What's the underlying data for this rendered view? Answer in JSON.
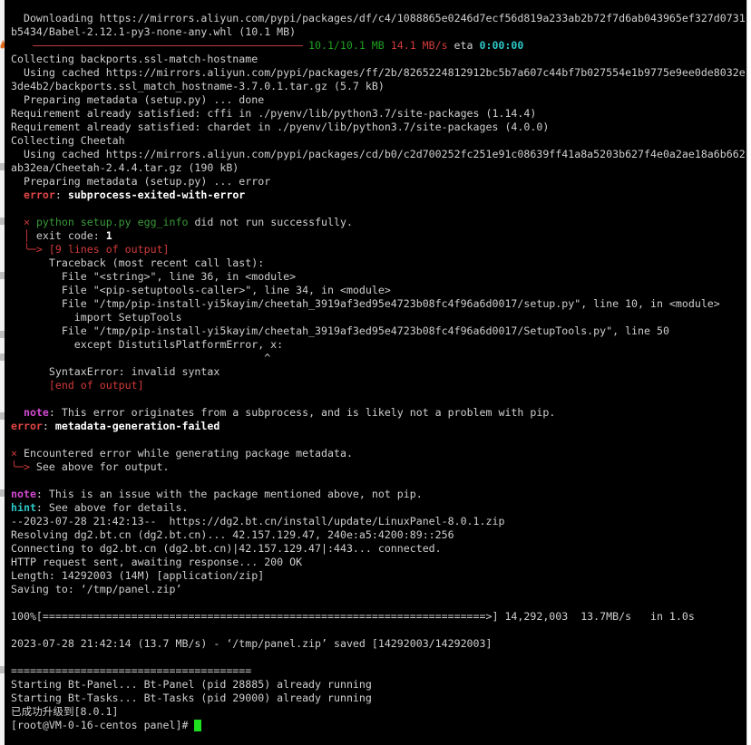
{
  "terminal": {
    "lines": [
      {
        "segments": [
          {
            "t": "  Downloading https://mirrors.aliyun.com/pypi/packages/df/c4/1088865e0246d7ecf56d819a233ab2b72f7d6ab043965ef327d0731"
          }
        ]
      },
      {
        "segments": [
          {
            "t": "b5434/Babel-2.12.1-py3-none-any.whl (10.1 MB)"
          }
        ]
      },
      {
        "progress": true,
        "segments": [
          {
            "t": "10.1/10.1 MB",
            "c": "c-green2"
          },
          {
            "t": " "
          },
          {
            "t": "14.1 MB/s",
            "c": "c-red"
          },
          {
            "t": " eta "
          },
          {
            "t": "0:00:00",
            "c": "c-cyan"
          }
        ]
      },
      {
        "segments": [
          {
            "t": "Collecting backports.ssl-match-hostname"
          }
        ]
      },
      {
        "segments": [
          {
            "t": "  Using cached https://mirrors.aliyun.com/pypi/packages/ff/2b/8265224812912bc5b7a607c44bf7b027554e1b9775e9ee0de8032e"
          }
        ]
      },
      {
        "segments": [
          {
            "t": "3de4b2/backports.ssl_match_hostname-3.7.0.1.tar.gz (5.7 kB)"
          }
        ]
      },
      {
        "segments": [
          {
            "t": "  Preparing metadata (setup.py) ... done"
          }
        ]
      },
      {
        "segments": [
          {
            "t": "Requirement already satisfied: cffi in ./pyenv/lib/python3.7/site-packages (1.14.4)"
          }
        ]
      },
      {
        "segments": [
          {
            "t": "Requirement already satisfied: chardet in ./pyenv/lib/python3.7/site-packages (4.0.0)"
          }
        ]
      },
      {
        "segments": [
          {
            "t": "Collecting Cheetah"
          }
        ]
      },
      {
        "segments": [
          {
            "t": "  Using cached https://mirrors.aliyun.com/pypi/packages/cd/b0/c2d700252fc251e91c08639ff41a8a5203b627f4e0a2ae18a6b662"
          }
        ]
      },
      {
        "segments": [
          {
            "t": "ab32ea/Cheetah-2.4.4.tar.gz (190 kB)"
          }
        ]
      },
      {
        "segments": [
          {
            "t": "  Preparing metadata (setup.py) ... error"
          }
        ]
      },
      {
        "segments": [
          {
            "t": "  "
          },
          {
            "t": "error",
            "c": "c-redb"
          },
          {
            "t": ": "
          },
          {
            "t": "subprocess-exited-with-error",
            "c": "c-whiteb"
          }
        ]
      },
      {
        "segments": [
          {
            "t": ""
          }
        ]
      },
      {
        "segments": [
          {
            "t": "  "
          },
          {
            "t": "×",
            "c": "c-red"
          },
          {
            "t": " "
          },
          {
            "t": "python setup.py egg_info",
            "c": "c-green"
          },
          {
            "t": " did not run successfully."
          }
        ]
      },
      {
        "segments": [
          {
            "t": "  "
          },
          {
            "t": "│",
            "c": "c-red"
          },
          {
            "t": " exit code: "
          },
          {
            "t": "1",
            "c": "c-whiteb"
          }
        ]
      },
      {
        "segments": [
          {
            "t": "  "
          },
          {
            "t": "╰─>",
            "c": "c-red"
          },
          {
            "t": " "
          },
          {
            "t": "[9 lines of output]",
            "c": "c-red"
          }
        ]
      },
      {
        "segments": [
          {
            "t": "      Traceback (most recent call last):"
          }
        ]
      },
      {
        "segments": [
          {
            "t": "        File \"<string>\", line 36, in <module>"
          }
        ]
      },
      {
        "segments": [
          {
            "t": "        File \"<pip-setuptools-caller>\", line 34, in <module>"
          }
        ]
      },
      {
        "segments": [
          {
            "t": "        File \"/tmp/pip-install-yi5kayim/cheetah_3919af3ed95e4723b08fc4f96a6d0017/setup.py\", line 10, in <module>"
          }
        ]
      },
      {
        "segments": [
          {
            "t": "          import SetupTools"
          }
        ]
      },
      {
        "segments": [
          {
            "t": "        File \"/tmp/pip-install-yi5kayim/cheetah_3919af3ed95e4723b08fc4f96a6d0017/SetupTools.py\", line 50"
          }
        ]
      },
      {
        "segments": [
          {
            "t": "          except DistutilsPlatformError, x:"
          }
        ]
      },
      {
        "segments": [
          {
            "t": "                                        ^"
          }
        ]
      },
      {
        "segments": [
          {
            "t": "      SyntaxError: invalid syntax"
          }
        ]
      },
      {
        "segments": [
          {
            "t": "      "
          },
          {
            "t": "[end of output]",
            "c": "c-red"
          }
        ]
      },
      {
        "segments": [
          {
            "t": ""
          }
        ]
      },
      {
        "segments": [
          {
            "t": "  "
          },
          {
            "t": "note",
            "c": "c-magenta"
          },
          {
            "t": ": This error originates from a subprocess, and is likely not a problem with pip."
          }
        ]
      },
      {
        "segments": [
          {
            "t": "error",
            "c": "c-redb"
          },
          {
            "t": ": "
          },
          {
            "t": "metadata-generation-failed",
            "c": "c-whiteb"
          }
        ]
      },
      {
        "segments": [
          {
            "t": ""
          }
        ]
      },
      {
        "segments": [
          {
            "t": "×",
            "c": "c-red"
          },
          {
            "t": " Encountered error while generating package metadata."
          }
        ]
      },
      {
        "segments": [
          {
            "t": "╰─>",
            "c": "c-red"
          },
          {
            "t": " See above for output."
          }
        ]
      },
      {
        "segments": [
          {
            "t": ""
          }
        ]
      },
      {
        "segments": [
          {
            "t": "note",
            "c": "c-magenta"
          },
          {
            "t": ": This is an issue with the package mentioned above, not pip."
          }
        ]
      },
      {
        "segments": [
          {
            "t": "hint",
            "c": "c-cyan"
          },
          {
            "t": ": See above for details."
          }
        ]
      },
      {
        "segments": [
          {
            "t": "--2023-07-28 21:42:13--  https://dg2.bt.cn/install/update/LinuxPanel-8.0.1.zip"
          }
        ]
      },
      {
        "segments": [
          {
            "t": "Resolving dg2.bt.cn (dg2.bt.cn)... 42.157.129.47, 240e:a5:4200:89::256"
          }
        ]
      },
      {
        "segments": [
          {
            "t": "Connecting to dg2.bt.cn (dg2.bt.cn)|42.157.129.47|:443... connected."
          }
        ]
      },
      {
        "segments": [
          {
            "t": "HTTP request sent, awaiting response... 200 OK"
          }
        ]
      },
      {
        "segments": [
          {
            "t": "Length: 14292003 (14M) [application/zip]"
          }
        ]
      },
      {
        "segments": [
          {
            "t": "Saving to: ‘/tmp/panel.zip’"
          }
        ]
      },
      {
        "segments": [
          {
            "t": ""
          }
        ]
      },
      {
        "segments": [
          {
            "t": "100%[======================================================================>] 14,292,003  13.7MB/s   in 1.0s"
          }
        ]
      },
      {
        "segments": [
          {
            "t": ""
          }
        ]
      },
      {
        "segments": [
          {
            "t": "2023-07-28 21:42:14 (13.7 MB/s) - ‘/tmp/panel.zip’ saved [14292003/14292003]"
          }
        ]
      },
      {
        "segments": [
          {
            "t": ""
          }
        ]
      },
      {
        "segments": [
          {
            "t": "======================================"
          }
        ]
      },
      {
        "segments": [
          {
            "t": "Starting Bt-Panel... Bt-Panel (pid 28885) already running"
          }
        ]
      },
      {
        "segments": [
          {
            "t": "Starting Bt-Tasks... Bt-Tasks (pid 29000) already running"
          }
        ]
      },
      {
        "segments": [
          {
            "t": "已成功升级到[8.0.1]"
          }
        ]
      },
      {
        "prompt": true,
        "segments": [
          {
            "t": "[root@VM-0-16-centos panel]# "
          }
        ]
      }
    ]
  }
}
